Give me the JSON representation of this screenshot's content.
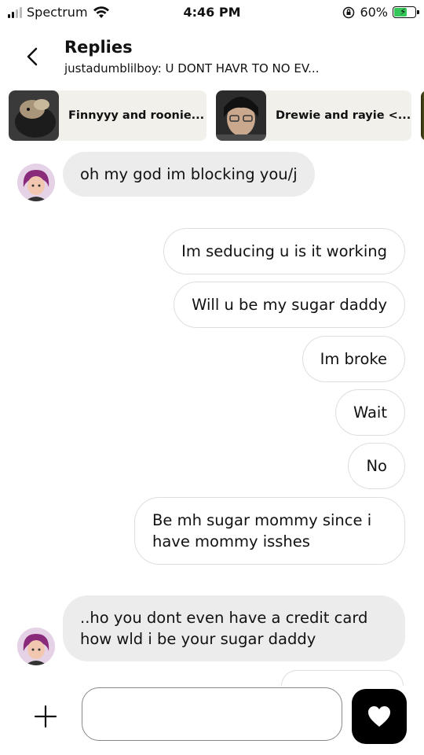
{
  "status_bar": {
    "carrier": "Spectrum",
    "time": "4:46 PM",
    "battery": "60%",
    "battery_level": 0.6
  },
  "header": {
    "title": "Replies",
    "subtitle": "justadumblilboy: U DONT HAVR TO NO EV..."
  },
  "stories": [
    {
      "label": "Finnyyy and roonie..."
    },
    {
      "label": "Drewie and rayie <..."
    }
  ],
  "messages": [
    {
      "direction": "in",
      "text": "oh my god im blocking you/j"
    },
    {
      "direction": "out",
      "text": "Im seducing u is it working"
    },
    {
      "direction": "out",
      "text": "Will u be my sugar daddy"
    },
    {
      "direction": "out",
      "text": "Im broke"
    },
    {
      "direction": "out",
      "text": "Wait"
    },
    {
      "direction": "out",
      "text": "No"
    },
    {
      "direction": "out",
      "text": "Be mh sugar mommy since i have mommy isshes"
    },
    {
      "direction": "in",
      "text": "..ho you dont even have a credit card how wld i be your sugar daddy"
    }
  ],
  "composer": {
    "placeholder": ""
  },
  "icons": {
    "back": "chevron-left-icon",
    "add": "plus-icon",
    "like": "heart-icon"
  }
}
